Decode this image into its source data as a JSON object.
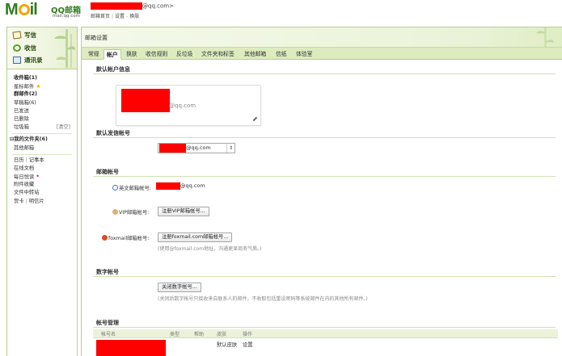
{
  "header": {
    "logo_text": "M",
    "logo_text2": "il",
    "logo_title": "QQ邮箱",
    "logo_url": "mail.qq.com",
    "email_suffix": "@qq.com>",
    "links": [
      "邮箱首页",
      "设置",
      "换肤"
    ]
  },
  "sidebar": {
    "quick": [
      {
        "label": "写信",
        "icon": "write-icon"
      },
      {
        "label": "收信",
        "icon": "inbox-icon"
      },
      {
        "label": "通讯录",
        "icon": "contacts-icon"
      }
    ],
    "folders": [
      {
        "label": "收件箱(1)",
        "bold": true
      },
      {
        "label": "星标邮件",
        "star": true
      },
      {
        "label": "群邮件(2)",
        "bold": true
      },
      {
        "label": "草稿箱(6)"
      },
      {
        "label": "已发送"
      },
      {
        "label": "已删除"
      },
      {
        "label": "垃圾箱",
        "clear": "[清空]"
      }
    ],
    "my_folders": "⊟我的文件夹(6)",
    "other_mail": "其他邮箱",
    "tools": [
      {
        "a": "日历",
        "b": "记事本"
      },
      {
        "a": "在线文档"
      },
      {
        "a": "每日悦读",
        "dot": "•"
      },
      {
        "a": "附件收藏"
      },
      {
        "a": "文件中转站"
      },
      {
        "a": "贺卡",
        "b": "明信片"
      }
    ]
  },
  "main": {
    "title": "邮箱设置",
    "tabs": [
      "常规",
      "帐户",
      "换肤",
      "收信规则",
      "反垃圾",
      "文件夹和标签",
      "其他邮箱",
      "信纸",
      "体验室"
    ],
    "active_tab": 1,
    "default_account": {
      "header": "默认帐户信息",
      "suffix": "@qq.com"
    },
    "default_sender": {
      "header": "默认发信帐号",
      "value": "@qq.com"
    },
    "accounts": {
      "header": "邮箱帐号",
      "english_label": "英文邮箱帐号:",
      "english_value": "@qq.com",
      "vip_label": "VIP邮箱帐号:",
      "vip_button": "注册VIP邮箱帐号...",
      "foxmail_label": "foxmail邮箱帐号:",
      "foxmail_button": "注册foxmail.com邮箱帐号...",
      "foxmail_note": "(使用@foxmail.com地址，沟通更显商务气质。)"
    },
    "digit_account": {
      "header": "数字帐号",
      "button": "关闭数字帐号...",
      "note": "(关闭后数字帐号只接收来自联系人的邮件，不收取包括重设密码等系统邮件在内的其他所有邮件。)"
    },
    "manage": {
      "header": "帐号管理",
      "columns": [
        "帐号名",
        "类型",
        "帮助",
        "皮肤",
        "操作"
      ],
      "rows": [
        {
          "c1": "默认皮肤",
          "c2": "设置"
        }
      ]
    }
  },
  "colors": {
    "brand_green": "#2f7d1e",
    "tab_bar": "#ddebbf",
    "redaction": "#fe0000"
  }
}
